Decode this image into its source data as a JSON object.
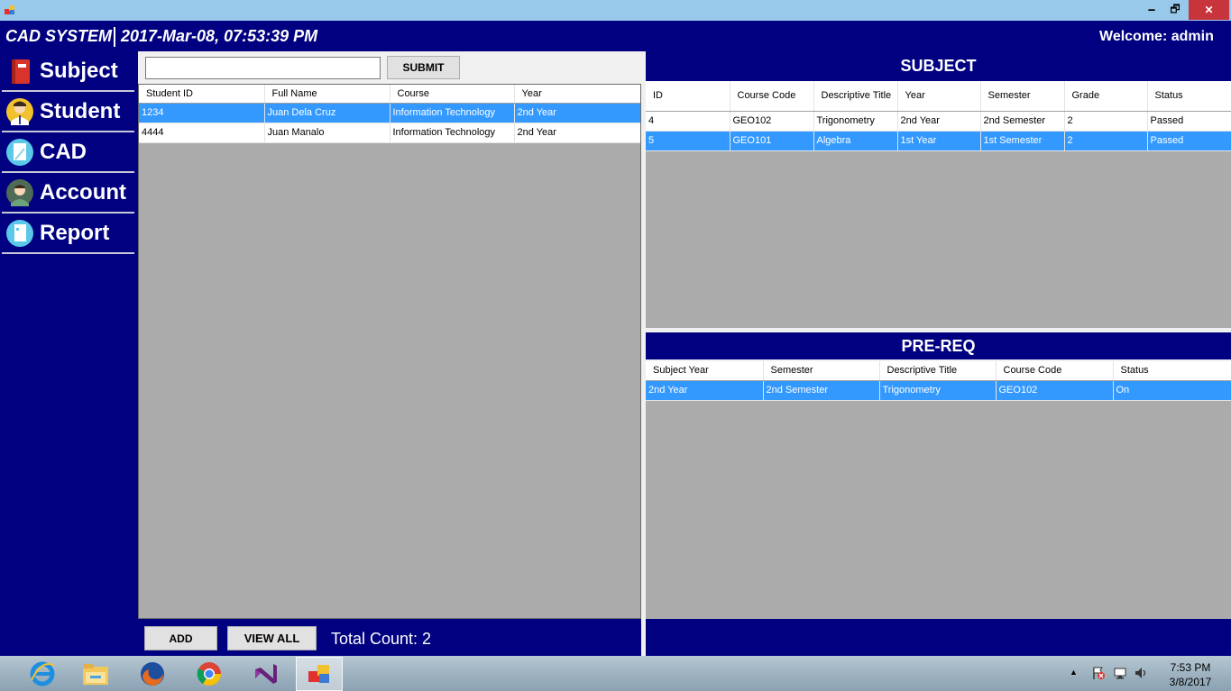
{
  "window": {
    "minimize": "🗕",
    "maximize": "🗗",
    "close": "✕"
  },
  "header": {
    "app_title": "CAD SYSTEM",
    "clock": "2017-Mar-08, 07:53:39 PM",
    "welcome": "Welcome: admin"
  },
  "sidebar": {
    "items": [
      {
        "label": "Subject",
        "icon": "book-icon"
      },
      {
        "label": "Student",
        "icon": "student-icon"
      },
      {
        "label": "CAD",
        "icon": "document-icon"
      },
      {
        "label": "Account",
        "icon": "user-icon"
      },
      {
        "label": "Report",
        "icon": "report-icon"
      }
    ]
  },
  "search": {
    "value": "",
    "placeholder": "",
    "submit_label": "SUBMIT"
  },
  "student_grid": {
    "columns": [
      "Student ID",
      "Full Name",
      "Course",
      "Year"
    ],
    "rows": [
      {
        "cells": [
          "1234",
          "Juan Dela Cruz",
          "Information Technology",
          "2nd Year"
        ],
        "selected": true
      },
      {
        "cells": [
          "4444",
          "Juan Manalo",
          "Information Technology",
          "2nd Year"
        ],
        "selected": false
      }
    ]
  },
  "student_footer": {
    "add_label": "ADD",
    "view_all_label": "VIEW ALL",
    "total_count": "Total Count: 2"
  },
  "subject_panel": {
    "title": "SUBJECT",
    "columns": [
      "ID",
      "Course Code",
      "Descriptive Title",
      "Year",
      "Semester",
      "Grade",
      "Status"
    ],
    "rows": [
      {
        "cells": [
          "4",
          "GEO102",
          "Trigonometry",
          "2nd Year",
          "2nd Semester",
          "2",
          "Passed"
        ],
        "selected": false
      },
      {
        "cells": [
          "5",
          "GEO101",
          "Algebra",
          "1st Year",
          "1st Semester",
          "2",
          "Passed"
        ],
        "selected": true
      }
    ]
  },
  "prereq_panel": {
    "title": "PRE-REQ",
    "columns": [
      "Subject Year",
      "Semester",
      "Descriptive Title",
      "Course Code",
      "Status"
    ],
    "rows": [
      {
        "cells": [
          "2nd Year",
          "2nd Semester",
          "Trigonometry",
          "GEO102",
          "On"
        ],
        "selected": true
      }
    ]
  },
  "taskbar": {
    "apps": [
      "internet-explorer-icon",
      "file-explorer-icon",
      "firefox-icon",
      "chrome-icon",
      "visual-studio-icon",
      "cad-app-icon"
    ],
    "time": "7:53 PM",
    "date": "3/8/2017"
  },
  "colors": {
    "navy": "#000080",
    "selection": "#3399ff",
    "grid_bg": "#ababab"
  }
}
